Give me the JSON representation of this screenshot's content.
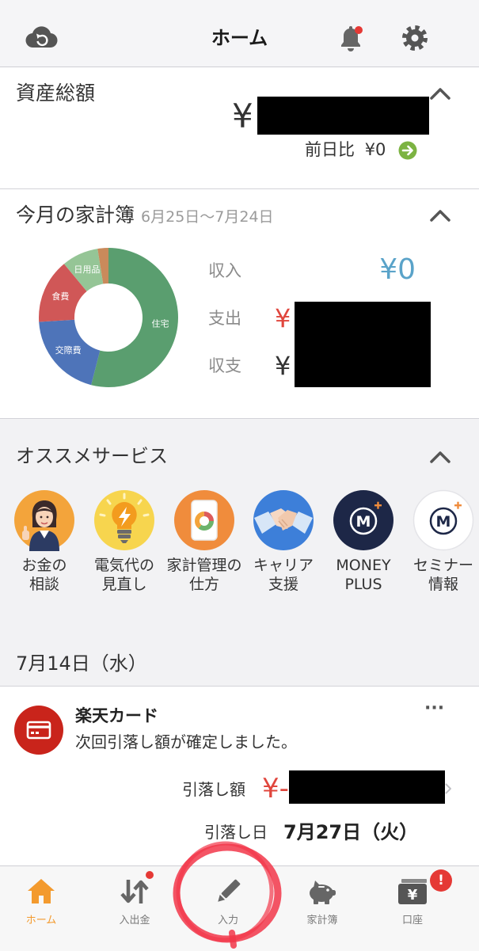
{
  "header": {
    "title": "ホーム",
    "left_icon": "cloud-sync-icon",
    "right_icons": [
      "bell-icon",
      "gear-icon"
    ]
  },
  "assets": {
    "title": "資産総額",
    "yen": "¥",
    "compare_label": "前日比",
    "compare_value": "¥0",
    "compare_icon": "arrow-right-circle-icon"
  },
  "budget": {
    "title": "今月の家計簿",
    "period": "6月25日〜7月24日",
    "income_label": "収入",
    "income_value": "¥0",
    "expense_label": "支出",
    "expense_yen": "¥",
    "balance_label": "収支",
    "balance_yen": "¥"
  },
  "chart_data": {
    "type": "pie",
    "donut": true,
    "title": "",
    "legend": "none",
    "slices": [
      {
        "label": "住宅",
        "value": 54,
        "color": "#5a9e6f"
      },
      {
        "label": "交際費",
        "value": 20,
        "color": "#4e74b9"
      },
      {
        "label": "食費",
        "value": 15,
        "color": "#d05757"
      },
      {
        "label": "日用品",
        "value": 8.5,
        "color": "#95c596"
      },
      {
        "label": "",
        "value": 2.5,
        "color": "#c98a5b"
      }
    ]
  },
  "services": {
    "title": "オススメサービス",
    "items": [
      {
        "icon": "consultation-woman-icon",
        "line1": "お金の",
        "line2": "相談"
      },
      {
        "icon": "lightbulb-icon",
        "line1": "電気代の",
        "line2": "見直し"
      },
      {
        "icon": "household-phone-icon",
        "line1": "家計管理の",
        "line2": "仕方"
      },
      {
        "icon": "handshake-icon",
        "line1": "キャリア",
        "line2": "支援"
      },
      {
        "icon": "money-plus-logo",
        "logo": "M",
        "line1": "MONEY",
        "line2": "PLUS"
      },
      {
        "icon": "seminar-logo",
        "logo": "M",
        "line1": "セミナー",
        "line2": "情報"
      }
    ]
  },
  "date_heading": "7月14日（水）",
  "notice": {
    "icon": "credit-card-icon",
    "title": "楽天カード",
    "message": "次回引落し額が確定しました。",
    "more_label": "···",
    "amount_label": "引落し額",
    "amount_yen": "¥-",
    "date_label": "引落し日",
    "date_value": "7月27日（火）"
  },
  "tabs": [
    {
      "label": "ホーム",
      "icon": "home-icon",
      "active": true
    },
    {
      "label": "入出金",
      "icon": "transfer-arrows-icon",
      "active": false,
      "has_dot": true
    },
    {
      "label": "入力",
      "icon": "pencil-icon",
      "active": false
    },
    {
      "label": "家計簿",
      "icon": "piggy-bank-icon",
      "active": false
    },
    {
      "label": "口座",
      "icon": "account-card-icon",
      "icon_glyph": "¥",
      "badge": "!",
      "active": false
    }
  ],
  "colors": {
    "accent": "#f39a2e",
    "income": "#5aa3c9",
    "expense": "#e0463d",
    "positive": "#7cb342",
    "alert": "#e53935",
    "annotation": "#f2374a"
  }
}
